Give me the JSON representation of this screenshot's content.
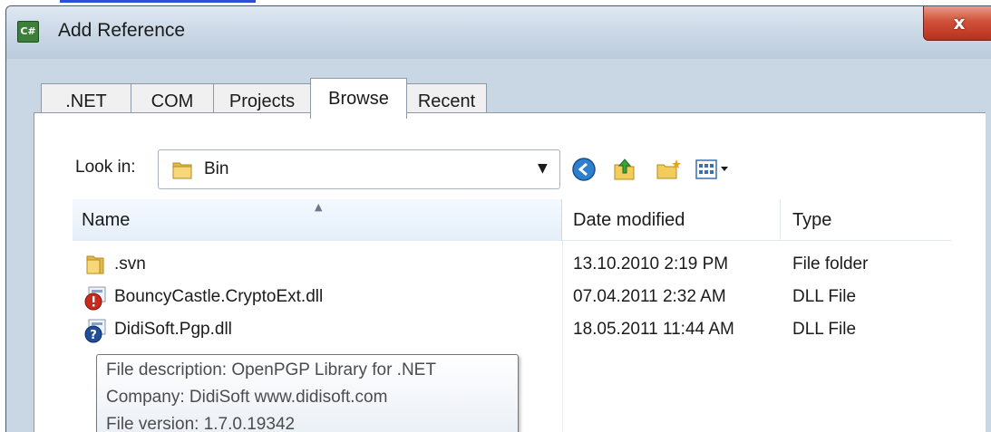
{
  "window": {
    "title": "Add Reference",
    "app_icon_text": "C#",
    "close_symbol": "x"
  },
  "tabs": [
    {
      "label": ".NET",
      "active": false
    },
    {
      "label": "COM",
      "active": false
    },
    {
      "label": "Projects",
      "active": false
    },
    {
      "label": "Browse",
      "active": true
    },
    {
      "label": "Recent",
      "active": false
    }
  ],
  "lookin": {
    "label": "Look in:",
    "value": "Bin",
    "dropdown_icon": "chevron-down-icon"
  },
  "toolbar": {
    "icons": [
      "back-icon",
      "up-folder-icon",
      "new-folder-icon",
      "view-menu-icon"
    ]
  },
  "columns": {
    "name": "Name",
    "date": "Date modified",
    "type": "Type"
  },
  "files": [
    {
      "name": ".svn",
      "date": "13.10.2010 2:19 PM",
      "type": "File folder",
      "icon": "folder-icon"
    },
    {
      "name": "BouncyCastle.CryptoExt.dll",
      "date": "07.04.2011 2:32 AM",
      "type": "DLL File",
      "icon": "dll-icon"
    },
    {
      "name": "DidiSoft.Pgp.dll",
      "date": "18.05.2011 11:44 AM",
      "type": "DLL File",
      "icon": "dll-icon"
    }
  ],
  "tooltip": {
    "description": "File description: OpenPGP Library for .NET",
    "company": "Company: DidiSoft www.didisoft.com",
    "version": "File version: 1.7.0.19342"
  },
  "colors": {
    "title_gradient_top": "#dfe8f2",
    "selected_header": "#e4eef9",
    "close_button": "#d0523a",
    "link_blue": "#2b4fd6"
  }
}
